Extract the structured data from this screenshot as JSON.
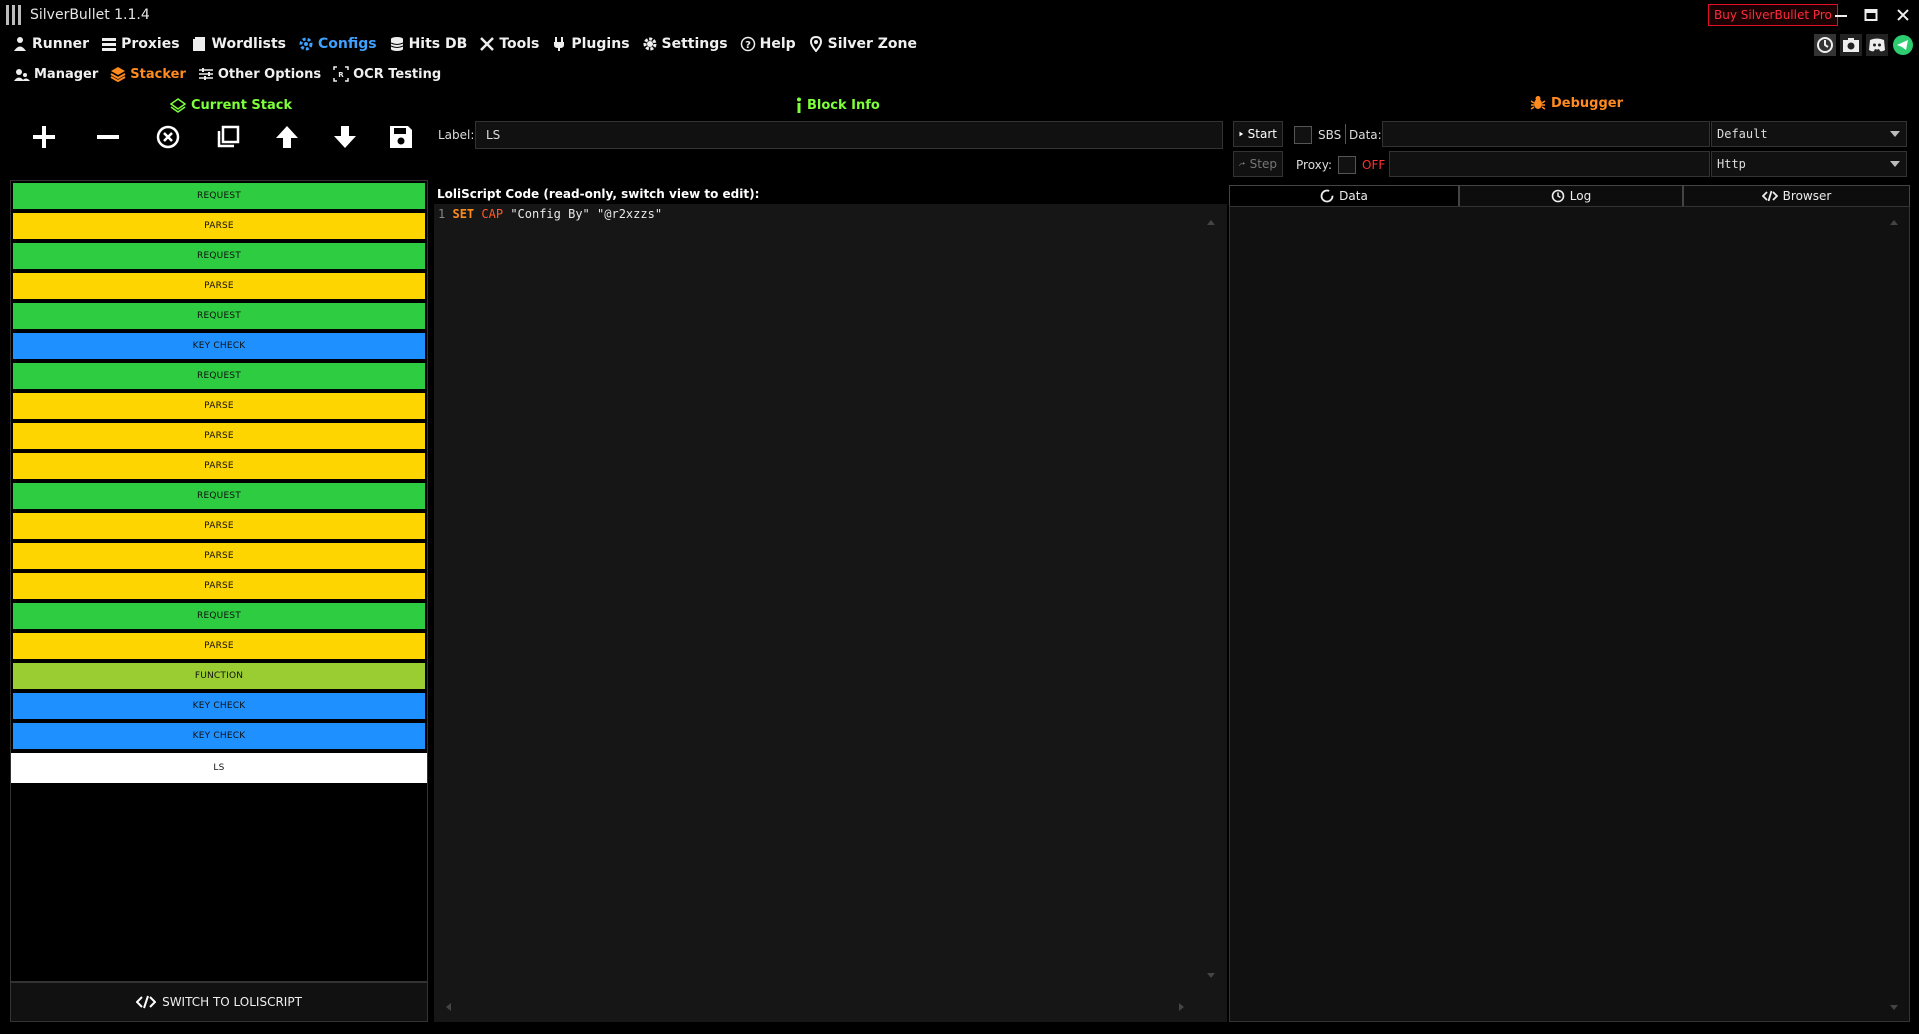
{
  "app": {
    "title": "SilverBullet 1.1.4",
    "buy_pro": "Buy SilverBullet Pro"
  },
  "menu": [
    {
      "label": "Runner",
      "icon": "runner-icon"
    },
    {
      "label": "Proxies",
      "icon": "proxies-icon"
    },
    {
      "label": "Wordlists",
      "icon": "wordlists-icon"
    },
    {
      "label": "Configs",
      "icon": "configs-icon",
      "active": true
    },
    {
      "label": "Hits DB",
      "icon": "database-icon"
    },
    {
      "label": "Tools",
      "icon": "tools-icon"
    },
    {
      "label": "Plugins",
      "icon": "plug-icon"
    },
    {
      "label": "Settings",
      "icon": "gear-icon"
    },
    {
      "label": "Help",
      "icon": "help-icon"
    },
    {
      "label": "Silver Zone",
      "icon": "pin-icon"
    }
  ],
  "submenu": [
    {
      "label": "Manager",
      "icon": "users-icon"
    },
    {
      "label": "Stacker",
      "icon": "layers-icon",
      "active": true
    },
    {
      "label": "Other Options",
      "icon": "sliders-icon"
    },
    {
      "label": "OCR Testing",
      "icon": "ocr-icon"
    }
  ],
  "sections": {
    "current_stack": "Current Stack",
    "block_info": "Block Info",
    "debugger": "Debugger"
  },
  "block_info": {
    "label_caption": "Label:",
    "label_value": "LS"
  },
  "stack": [
    {
      "name": "REQUEST",
      "type": "request"
    },
    {
      "name": "PARSE",
      "type": "parse"
    },
    {
      "name": "REQUEST",
      "type": "request"
    },
    {
      "name": "PARSE",
      "type": "parse"
    },
    {
      "name": "REQUEST",
      "type": "request"
    },
    {
      "name": "KEY CHECK",
      "type": "keycheck"
    },
    {
      "name": "REQUEST",
      "type": "request"
    },
    {
      "name": "PARSE",
      "type": "parse"
    },
    {
      "name": "PARSE",
      "type": "parse"
    },
    {
      "name": "PARSE",
      "type": "parse"
    },
    {
      "name": "REQUEST",
      "type": "request"
    },
    {
      "name": "PARSE",
      "type": "parse"
    },
    {
      "name": "PARSE",
      "type": "parse"
    },
    {
      "name": "PARSE",
      "type": "parse"
    },
    {
      "name": "REQUEST",
      "type": "request"
    },
    {
      "name": "PARSE",
      "type": "parse"
    },
    {
      "name": "FUNCTION",
      "type": "function"
    },
    {
      "name": "KEY CHECK",
      "type": "keycheck"
    },
    {
      "name": "KEY CHECK",
      "type": "keycheck"
    },
    {
      "name": "LS",
      "type": "ls"
    }
  ],
  "switch_button": "SWITCH TO LOLISCRIPT",
  "code": {
    "title": "LoliScript Code (read-only, switch view to edit):",
    "line_number": "1",
    "kw_set": "SET",
    "kw_cap": "CAP",
    "arg1": "\"Config By\"",
    "arg2": "\"@r2xzzs\""
  },
  "debugger": {
    "start": "Start",
    "step": "Step",
    "sbs": "SBS",
    "data_label": "Data:",
    "proxy_label": "Proxy:",
    "proxy_state": "OFF",
    "wordlist_type": "Default",
    "proxy_type": "Http",
    "tabs": [
      "Data",
      "Log",
      "Browser"
    ]
  },
  "colors": {
    "request": "#2ecc40",
    "parse": "#ffd500",
    "keycheck": "#1e90ff",
    "function": "#9acd32",
    "accent_blue": "#3ea0ff",
    "accent_orange": "#ff8a1f",
    "accent_green": "#7dff3a"
  }
}
